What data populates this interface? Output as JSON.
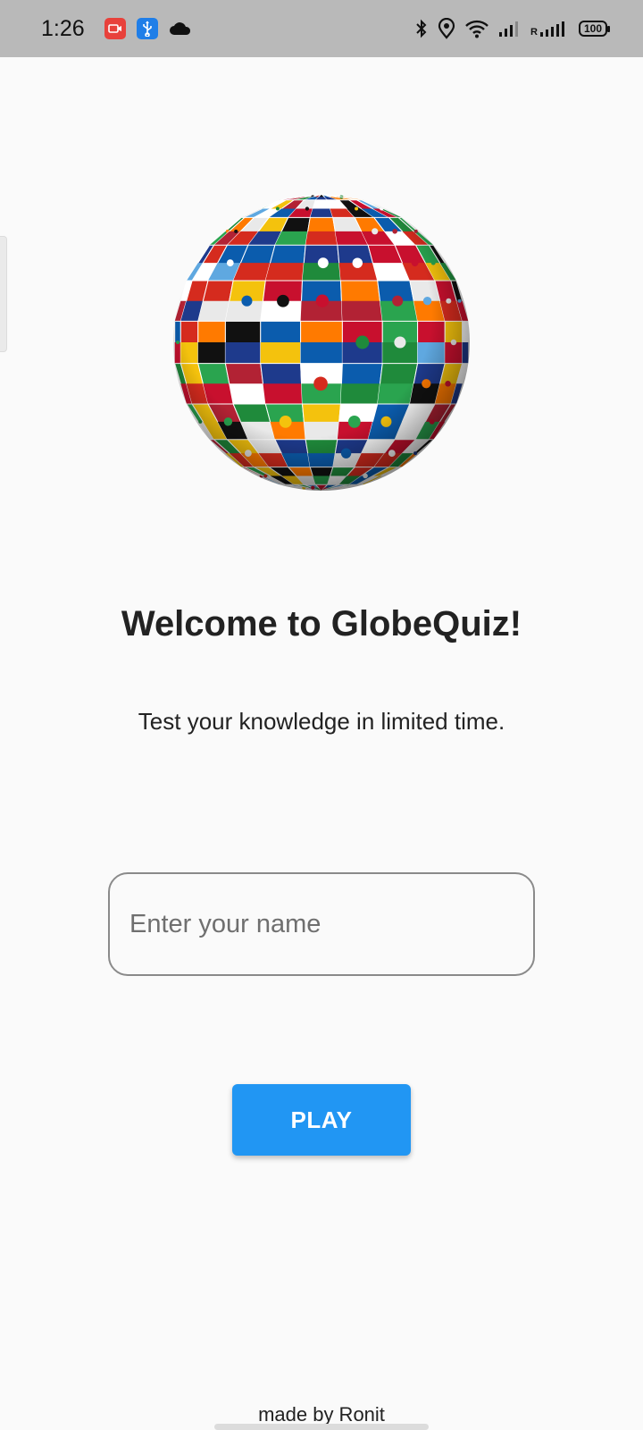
{
  "status_bar": {
    "time": "1:26",
    "battery": "100",
    "left_icons": [
      "screen-recorder-icon",
      "usb-debugging-icon",
      "cloud-icon"
    ],
    "right_icons": [
      "bluetooth-icon",
      "location-icon",
      "wifi-icon",
      "signal-icon",
      "signal-roaming-icon",
      "battery-icon"
    ],
    "roaming_letter": "R"
  },
  "hero": {
    "image": "flag-globe-image"
  },
  "welcome": {
    "title": "Welcome to GlobeQuiz!",
    "subtitle": "Test your knowledge in limited time."
  },
  "form": {
    "name_placeholder": "Enter your name",
    "name_value": "",
    "play_label": "PLAY"
  },
  "footer": {
    "credit": "made by Ronit"
  },
  "colors": {
    "background": "#fafafa",
    "status_bar": "#b9b9b9",
    "accent": "#2196f3",
    "text": "#222222"
  }
}
